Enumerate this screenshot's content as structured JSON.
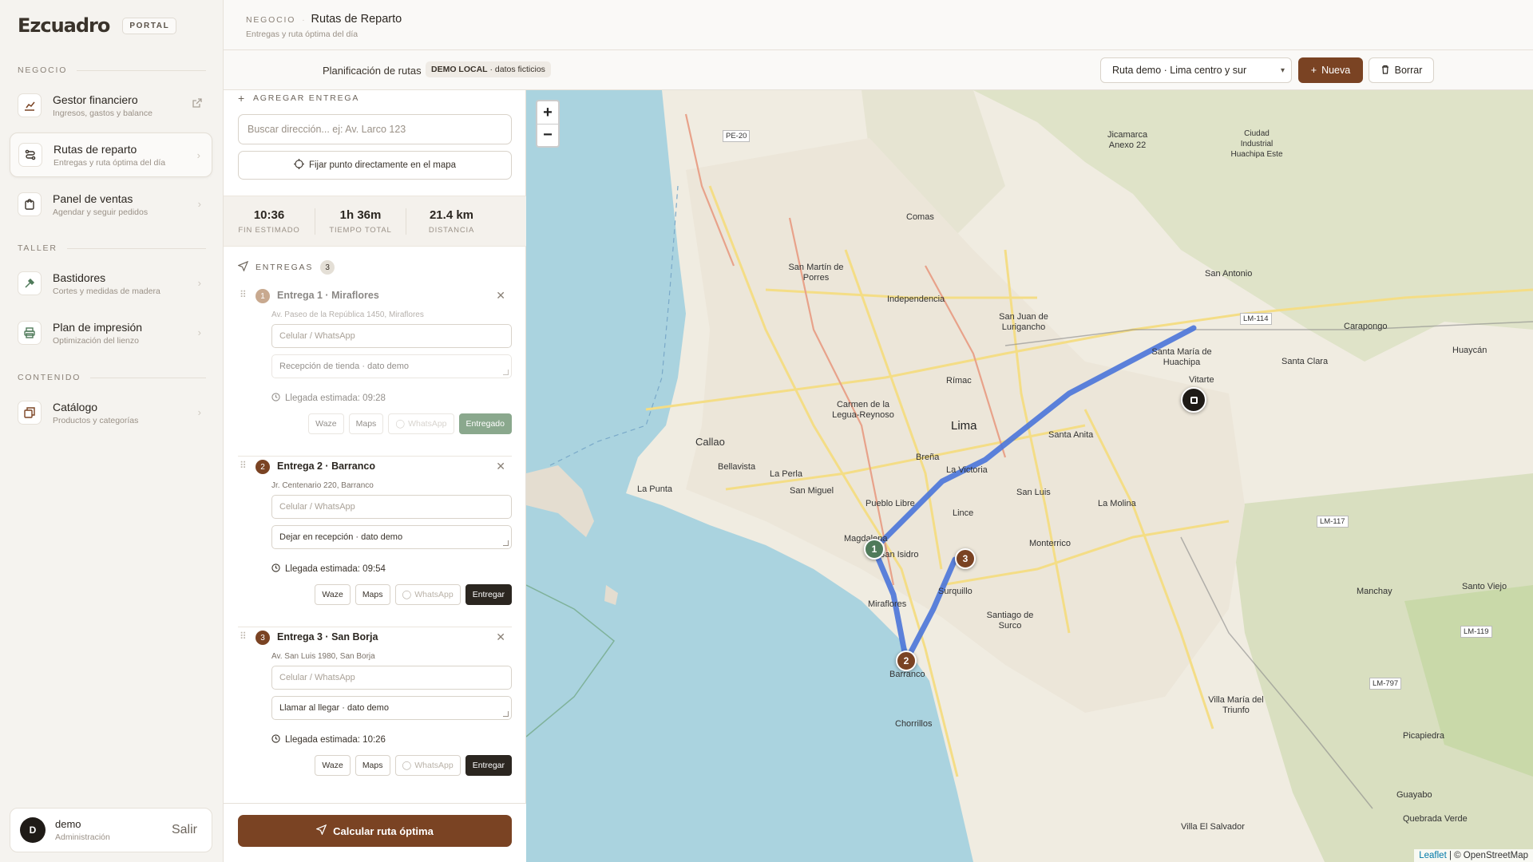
{
  "brand": {
    "logo": "Ezcuadro",
    "badge": "PORTAL"
  },
  "sidebar": {
    "sections": [
      {
        "label": "NEGOCIO"
      },
      {
        "label": "TALLER"
      },
      {
        "label": "CONTENIDO"
      }
    ],
    "items": [
      {
        "title": "Gestor financiero",
        "sub": "Ingresos, gastos y balance"
      },
      {
        "title": "Rutas de reparto",
        "sub": "Entregas y ruta óptima del día"
      },
      {
        "title": "Panel de ventas",
        "sub": "Agendar y seguir pedidos"
      },
      {
        "title": "Bastidores",
        "sub": "Cortes y medidas de madera"
      },
      {
        "title": "Plan de impresión",
        "sub": "Optimización del lienzo"
      },
      {
        "title": "Catálogo",
        "sub": "Productos y categorías"
      }
    ],
    "user": {
      "initial": "D",
      "name": "demo",
      "role": "Administración",
      "logout": "Salir"
    }
  },
  "header": {
    "crumb_root": "NEGOCIO",
    "crumb_sep": "·",
    "title": "Rutas de Reparto",
    "subtitle": "Entregas y ruta óptima del día"
  },
  "toolbar": {
    "title": "Planificación de rutas",
    "badge_strong": "DEMO LOCAL",
    "badge_rest": " · datos ficticios",
    "route_selected": "Ruta demo · Lima centro y sur",
    "new_label": "Nueva",
    "delete_label": "Borrar"
  },
  "panel": {
    "add_heading": "AGREGAR ENTREGA",
    "search_placeholder": "Buscar dirección... ej: Av. Larco 123",
    "pin_label": "Fijar punto directamente en el mapa",
    "stats": [
      {
        "value": "10:36",
        "label": "FIN ESTIMADO"
      },
      {
        "value": "1h 36m",
        "label": "TIEMPO TOTAL"
      },
      {
        "value": "21.4 km",
        "label": "DISTANCIA"
      }
    ],
    "deliveries_heading": "ENTREGAS",
    "deliveries_count": "3",
    "phone_placeholder": "Celular / WhatsApp",
    "deliveries": [
      {
        "num": "1",
        "title": "Entrega 1 · Miraflores",
        "address": "Av. Paseo de la República 1450, Miraflores",
        "note": "Recepción de tienda · dato demo",
        "eta": "Llegada estimada: 09:28",
        "status": "Entregado"
      },
      {
        "num": "2",
        "title": "Entrega 2 · Barranco",
        "address": "Jr. Centenario 220, Barranco",
        "note": "Dejar en recepción · dato demo",
        "eta": "Llegada estimada: 09:54",
        "status": "Entregar"
      },
      {
        "num": "3",
        "title": "Entrega 3 · San Borja",
        "address": "Av. San Luis 1980, San Borja",
        "note": "Llamar al llegar · dato demo",
        "eta": "Llegada estimada: 10:26",
        "status": "Entregar"
      }
    ],
    "actions": {
      "waze": "Waze",
      "maps": "Maps",
      "whatsapp": "WhatsApp"
    },
    "calc_label": "Calcular ruta óptima"
  },
  "map": {
    "zoom_in": "+",
    "zoom_out": "−",
    "labels": [
      "Lima",
      "Callao",
      "La Punta",
      "Bellavista",
      "La Perla",
      "San Miguel",
      "Pueblo Libre",
      "Breña",
      "La Victoria",
      "San Luis",
      "Lince",
      "Magdalena",
      "San Isidro",
      "Miraflores",
      "Surquillo",
      "Barranco",
      "Chorrillos",
      "Santiago de Surco",
      "Monterrico",
      "La Molina",
      "Santa Anita",
      "Vitarte",
      "Rímac",
      "Independencia",
      "Comas",
      "San Martín de Porres",
      "Carmen de la Legua-Reynoso",
      "San Juan de Lurigancho",
      "Jicamarca Anexo 22",
      "Ciudad Industrial Huachipa Este",
      "San Antonio",
      "Santa María de Huachipa",
      "Santa Clara",
      "Carapongo",
      "Huaycán",
      "Manchay",
      "Santo Viejo",
      "Villa María del Triunfo",
      "Villa El Salvador",
      "Picapiedra",
      "Guayabo",
      "Quebrada Verde"
    ],
    "road_labels": [
      "PE-20",
      "LM-114",
      "LM-117",
      "LM-119",
      "LM-797"
    ],
    "markers": [
      "1",
      "2",
      "3"
    ],
    "attribution_leaflet": "Leaflet",
    "attribution_rest": " | © OpenStreetMap"
  },
  "colors": {
    "accent": "#7a4323",
    "delivered": "#8aa88d",
    "route": "#4a74d9"
  }
}
